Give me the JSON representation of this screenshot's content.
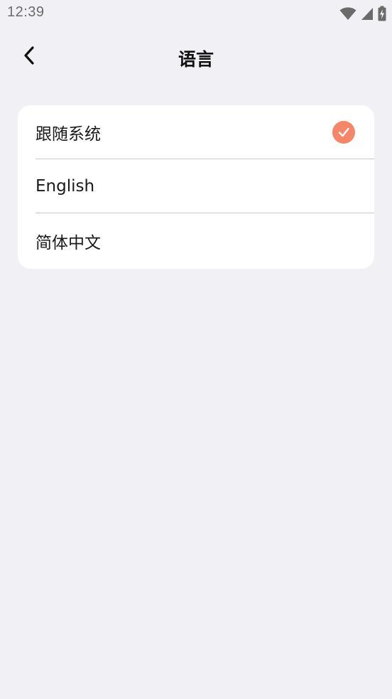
{
  "status_bar": {
    "time": "12:39",
    "icons": [
      "wifi-icon",
      "cellular-signal-icon",
      "battery-charging-icon"
    ]
  },
  "app_bar": {
    "back_icon": "chevron-left-icon",
    "title": "语言"
  },
  "languages": {
    "selected_index": 0,
    "items": [
      {
        "label": "跟随系统",
        "selected": true
      },
      {
        "label": "English",
        "selected": false
      },
      {
        "label": "简体中文",
        "selected": false
      }
    ]
  },
  "colors": {
    "background": "#f1f0f5",
    "card": "#ffffff",
    "accent": "#f4876a",
    "divider": "#c9c9c9"
  }
}
